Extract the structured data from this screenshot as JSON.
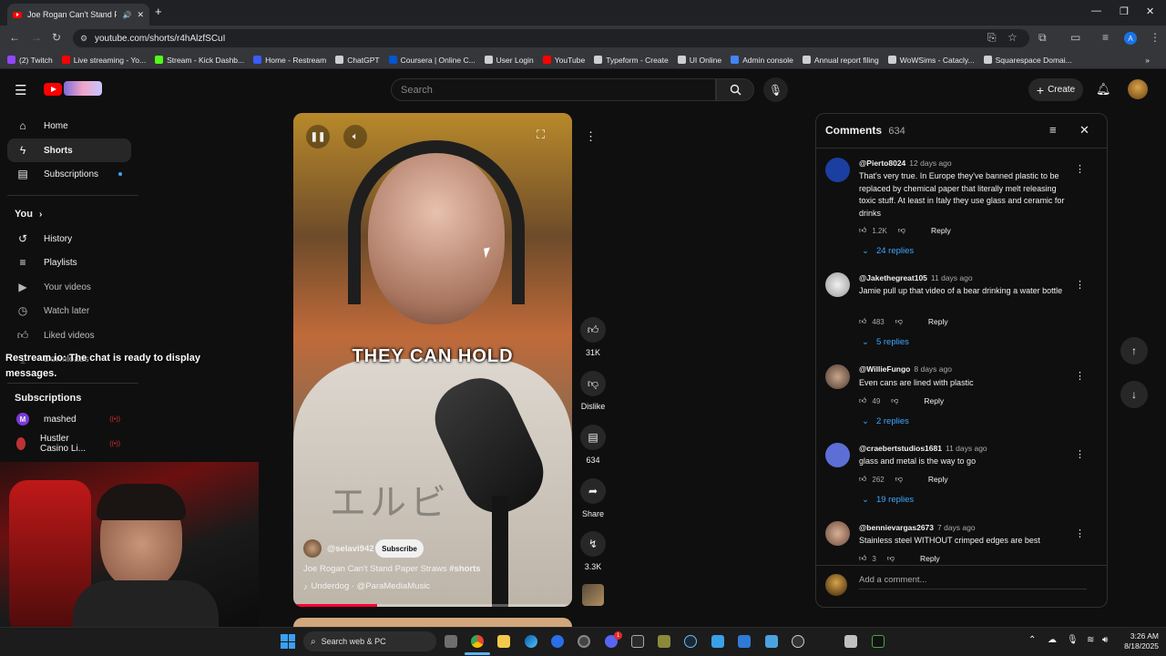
{
  "browser": {
    "tab_title": "Joe Rogan Can't Stand Pape",
    "url": "youtube.com/shorts/r4hAlzfSCuI",
    "bookmarks": [
      {
        "label": "(2) Twitch",
        "color": "#9146ff"
      },
      {
        "label": "Live streaming - Yo...",
        "color": "#ff0000"
      },
      {
        "label": "Stream - Kick Dashb...",
        "color": "#53fc18"
      },
      {
        "label": "Home - Restream",
        "color": "#3b5bfd"
      },
      {
        "label": "ChatGPT",
        "color": "#cfcfcf"
      },
      {
        "label": "Coursera | Online C...",
        "color": "#0056d2"
      },
      {
        "label": "User Login",
        "color": "#cfcfcf"
      },
      {
        "label": "YouTube",
        "color": "#ff0000"
      },
      {
        "label": "Typeform - Create",
        "color": "#cfcfcf"
      },
      {
        "label": "UI Online",
        "color": "#cfcfcf"
      },
      {
        "label": "Admin console",
        "color": "#4285f4"
      },
      {
        "label": "Annual report filing",
        "color": "#cfcfcf"
      },
      {
        "label": "WoWSims - Catacly...",
        "color": "#cfcfcf"
      },
      {
        "label": "Squarespace Domai...",
        "color": "#cfcfcf"
      }
    ],
    "profile_initial": "A"
  },
  "masthead": {
    "search_placeholder": "Search",
    "create_label": "Create"
  },
  "sidebar": {
    "main": [
      "Home",
      "Shorts",
      "Subscriptions"
    ],
    "you_label": "You",
    "you_items": [
      "History",
      "Playlists",
      "Your videos",
      "Watch later",
      "Liked videos",
      "Downloads"
    ],
    "subs_title": "Subscriptions",
    "subs": [
      "mashed",
      "Hustler Casino Li..."
    ]
  },
  "overlay": {
    "chat_line": "Restream.io: The chat is ready to display messages."
  },
  "video": {
    "caption": "THEY CAN HOLD",
    "channel": "@selavi942",
    "subscribe_label": "Subscribe",
    "title": "Joe Rogan Can't Stand Paper Straws",
    "hashtag": "#shorts",
    "music": "Underdog · @ParaMediaMusic",
    "likes": "31K",
    "dislike_label": "Dislike",
    "comment_count": "634",
    "share_label": "Share",
    "remix_count": "3.3K"
  },
  "comments": {
    "title": "Comments",
    "count": "634",
    "add_placeholder": "Add a comment...",
    "items": [
      {
        "user": "@Pierto8024",
        "time": "12 days ago",
        "text": "That's very true. In Europe they've banned plastic to be replaced by chemical paper that literally melt releasing toxic stuff. At least in Italy they use glass and ceramic for drinks",
        "likes": "1.2K",
        "replies": "24 replies",
        "reply_label": "Reply"
      },
      {
        "user": "@Jakethegreat105",
        "time": "11 days ago",
        "text": "Jamie pull up that video of a bear drinking a water bottle",
        "likes": "483",
        "replies": "5 replies",
        "reply_label": "Reply"
      },
      {
        "user": "@WillieFungo",
        "time": "8 days ago",
        "text": "Even cans are lined with plastic",
        "likes": "49",
        "replies": "2 replies",
        "reply_label": "Reply"
      },
      {
        "user": "@craebertstudios1681",
        "time": "11 days ago",
        "text": "glass and metal is the way to go",
        "likes": "262",
        "replies": "19 replies",
        "reply_label": "Reply"
      },
      {
        "user": "@bennievargas2673",
        "time": "7 days ago",
        "text": "Stainless steel WITHOUT crimped edges are best",
        "likes": "3",
        "replies": "",
        "reply_label": "Reply"
      }
    ]
  },
  "taskbar": {
    "search_label": "Search web & PC",
    "time": "3:26 AM",
    "date": "8/18/2025",
    "discord_badge": "1"
  }
}
